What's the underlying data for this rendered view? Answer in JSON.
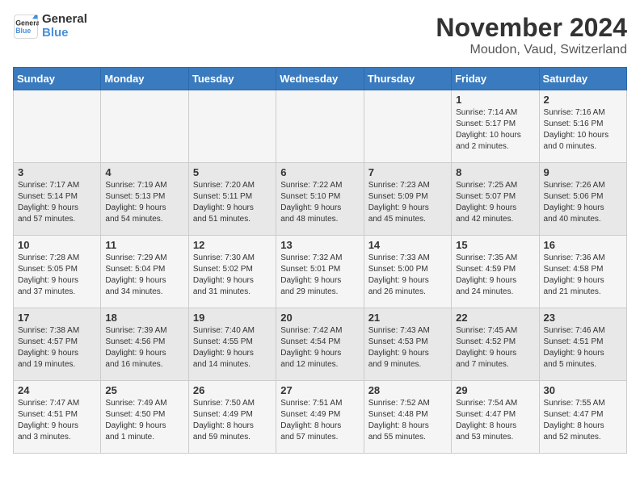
{
  "logo": {
    "line1": "General",
    "line2": "Blue"
  },
  "title": "November 2024",
  "location": "Moudon, Vaud, Switzerland",
  "weekdays": [
    "Sunday",
    "Monday",
    "Tuesday",
    "Wednesday",
    "Thursday",
    "Friday",
    "Saturday"
  ],
  "weeks": [
    [
      {
        "day": "",
        "info": ""
      },
      {
        "day": "",
        "info": ""
      },
      {
        "day": "",
        "info": ""
      },
      {
        "day": "",
        "info": ""
      },
      {
        "day": "",
        "info": ""
      },
      {
        "day": "1",
        "info": "Sunrise: 7:14 AM\nSunset: 5:17 PM\nDaylight: 10 hours\nand 2 minutes."
      },
      {
        "day": "2",
        "info": "Sunrise: 7:16 AM\nSunset: 5:16 PM\nDaylight: 10 hours\nand 0 minutes."
      }
    ],
    [
      {
        "day": "3",
        "info": "Sunrise: 7:17 AM\nSunset: 5:14 PM\nDaylight: 9 hours\nand 57 minutes."
      },
      {
        "day": "4",
        "info": "Sunrise: 7:19 AM\nSunset: 5:13 PM\nDaylight: 9 hours\nand 54 minutes."
      },
      {
        "day": "5",
        "info": "Sunrise: 7:20 AM\nSunset: 5:11 PM\nDaylight: 9 hours\nand 51 minutes."
      },
      {
        "day": "6",
        "info": "Sunrise: 7:22 AM\nSunset: 5:10 PM\nDaylight: 9 hours\nand 48 minutes."
      },
      {
        "day": "7",
        "info": "Sunrise: 7:23 AM\nSunset: 5:09 PM\nDaylight: 9 hours\nand 45 minutes."
      },
      {
        "day": "8",
        "info": "Sunrise: 7:25 AM\nSunset: 5:07 PM\nDaylight: 9 hours\nand 42 minutes."
      },
      {
        "day": "9",
        "info": "Sunrise: 7:26 AM\nSunset: 5:06 PM\nDaylight: 9 hours\nand 40 minutes."
      }
    ],
    [
      {
        "day": "10",
        "info": "Sunrise: 7:28 AM\nSunset: 5:05 PM\nDaylight: 9 hours\nand 37 minutes."
      },
      {
        "day": "11",
        "info": "Sunrise: 7:29 AM\nSunset: 5:04 PM\nDaylight: 9 hours\nand 34 minutes."
      },
      {
        "day": "12",
        "info": "Sunrise: 7:30 AM\nSunset: 5:02 PM\nDaylight: 9 hours\nand 31 minutes."
      },
      {
        "day": "13",
        "info": "Sunrise: 7:32 AM\nSunset: 5:01 PM\nDaylight: 9 hours\nand 29 minutes."
      },
      {
        "day": "14",
        "info": "Sunrise: 7:33 AM\nSunset: 5:00 PM\nDaylight: 9 hours\nand 26 minutes."
      },
      {
        "day": "15",
        "info": "Sunrise: 7:35 AM\nSunset: 4:59 PM\nDaylight: 9 hours\nand 24 minutes."
      },
      {
        "day": "16",
        "info": "Sunrise: 7:36 AM\nSunset: 4:58 PM\nDaylight: 9 hours\nand 21 minutes."
      }
    ],
    [
      {
        "day": "17",
        "info": "Sunrise: 7:38 AM\nSunset: 4:57 PM\nDaylight: 9 hours\nand 19 minutes."
      },
      {
        "day": "18",
        "info": "Sunrise: 7:39 AM\nSunset: 4:56 PM\nDaylight: 9 hours\nand 16 minutes."
      },
      {
        "day": "19",
        "info": "Sunrise: 7:40 AM\nSunset: 4:55 PM\nDaylight: 9 hours\nand 14 minutes."
      },
      {
        "day": "20",
        "info": "Sunrise: 7:42 AM\nSunset: 4:54 PM\nDaylight: 9 hours\nand 12 minutes."
      },
      {
        "day": "21",
        "info": "Sunrise: 7:43 AM\nSunset: 4:53 PM\nDaylight: 9 hours\nand 9 minutes."
      },
      {
        "day": "22",
        "info": "Sunrise: 7:45 AM\nSunset: 4:52 PM\nDaylight: 9 hours\nand 7 minutes."
      },
      {
        "day": "23",
        "info": "Sunrise: 7:46 AM\nSunset: 4:51 PM\nDaylight: 9 hours\nand 5 minutes."
      }
    ],
    [
      {
        "day": "24",
        "info": "Sunrise: 7:47 AM\nSunset: 4:51 PM\nDaylight: 9 hours\nand 3 minutes."
      },
      {
        "day": "25",
        "info": "Sunrise: 7:49 AM\nSunset: 4:50 PM\nDaylight: 9 hours\nand 1 minute."
      },
      {
        "day": "26",
        "info": "Sunrise: 7:50 AM\nSunset: 4:49 PM\nDaylight: 8 hours\nand 59 minutes."
      },
      {
        "day": "27",
        "info": "Sunrise: 7:51 AM\nSunset: 4:49 PM\nDaylight: 8 hours\nand 57 minutes."
      },
      {
        "day": "28",
        "info": "Sunrise: 7:52 AM\nSunset: 4:48 PM\nDaylight: 8 hours\nand 55 minutes."
      },
      {
        "day": "29",
        "info": "Sunrise: 7:54 AM\nSunset: 4:47 PM\nDaylight: 8 hours\nand 53 minutes."
      },
      {
        "day": "30",
        "info": "Sunrise: 7:55 AM\nSunset: 4:47 PM\nDaylight: 8 hours\nand 52 minutes."
      }
    ]
  ]
}
